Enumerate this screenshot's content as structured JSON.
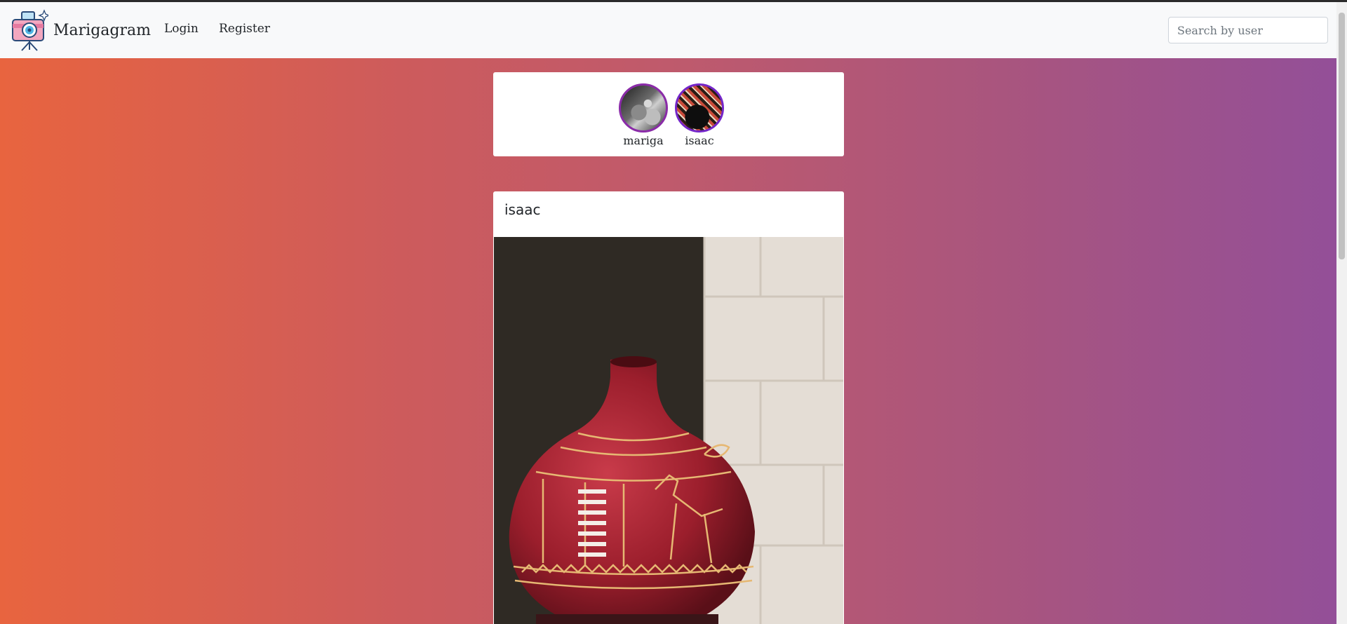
{
  "navbar": {
    "brand": "Marigagram",
    "links": [
      {
        "label": "Login"
      },
      {
        "label": "Register"
      }
    ],
    "search_placeholder": "Search by user"
  },
  "stories": [
    {
      "username": "mariga"
    },
    {
      "username": "isaac"
    }
  ],
  "post": {
    "username": "isaac",
    "image_subject": "vase-photo"
  },
  "colors": {
    "gradient_start": "#e8643f",
    "gradient_end": "#934f98",
    "avatar_ring": "#8a2ba8",
    "navbar_bg": "#f8f9fa"
  }
}
